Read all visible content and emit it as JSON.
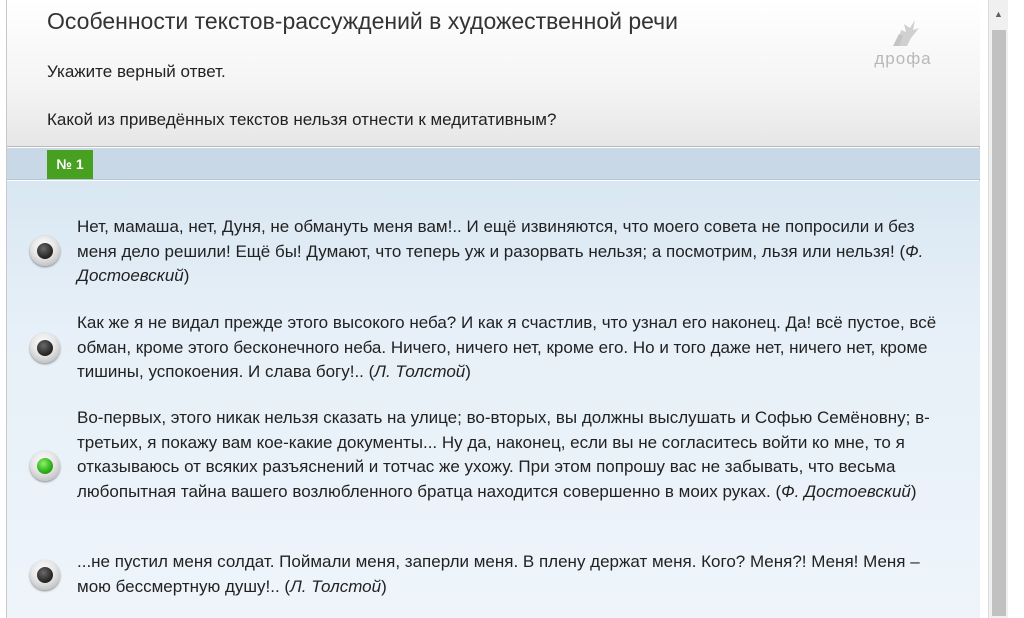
{
  "header": {
    "title": "Особенности текстов-рассуждений в художественной речи",
    "instruction": "Укажите верный ответ.",
    "question": "Какой из приведённых текстов нельзя отнести к медитативным?",
    "logo_text": "дрофа"
  },
  "question_number": "№ 1",
  "answers": [
    {
      "text": "Нет, мамаша, нет, Дуня, не обмануть меня вам!.. И ещё извиняются, что моего совета не попросили и без меня дело решили! Ещё бы! Думают, что теперь уж и разорвать нельзя; а посмотрим, льзя или нельзя! (",
      "author": "Ф. Достоевский",
      "tail": ")",
      "selected": false
    },
    {
      "text": "Как же я не видал прежде этого высокого неба? И как я счастлив, что узнал его наконец. Да! всё пустое, всё обман, кроме этого бесконечного неба. Ничего, ничего нет, кроме его. Но и того даже нет, ничего нет, кроме тишины, успокоения. И слава богу!.. (",
      "author": "Л. Толстой",
      "tail": ")",
      "selected": false
    },
    {
      "text": "Во-первых, этого никак нельзя сказать на улице; во-вторых, вы должны выслушать и Софью Семёновну; в-третьих, я покажу вам кое-какие документы... Ну да, наконец, если вы не согласитесь войти ко мне, то я отказываюсь от всяких разъяснений и тотчас же ухожу. При этом попрошу вас не забывать, что весьма любопытная тайна вашего возлюбленного братца находится совершенно в моих руках. (",
      "author": "Ф. Достоевский",
      "tail": ")",
      "selected": true
    },
    {
      "text": "...не пустил меня солдат. Поймали меня, заперли меня. В плену держат меня. Кого? Меня?! Меня! Меня – мою бессмертную душу!.. (",
      "author": "Л. Толстой",
      "tail": ")",
      "selected": false
    }
  ],
  "colors": {
    "badge": "#47a01f",
    "selected_radio": "#2fb51c",
    "answers_background": "#e7f0f8"
  }
}
